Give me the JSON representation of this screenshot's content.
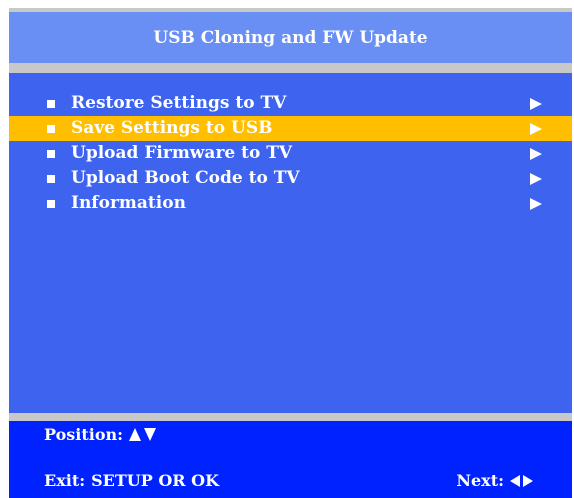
{
  "title": "USB Cloning and FW Update",
  "menu": {
    "items": [
      {
        "label": "Restore Settings to TV",
        "selected": false
      },
      {
        "label": "Save Settings to USB",
        "selected": true
      },
      {
        "label": "Upload Firmware to TV",
        "selected": false
      },
      {
        "label": "Upload Boot Code to TV",
        "selected": false
      },
      {
        "label": "Information",
        "selected": false
      }
    ],
    "bullet_icon": "square-bullet-icon",
    "submenu_icon": "right-triangle-arrow-icon"
  },
  "footer": {
    "position_label": "Position:",
    "position_icons": [
      "up-triangle-icon",
      "down-triangle-icon"
    ],
    "exit_label": "Exit:",
    "exit_keys": "SETUP OR OK",
    "next_label": "Next:",
    "next_icons": [
      "left-triangle-icon",
      "right-triangle-icon"
    ]
  },
  "colors": {
    "frame_blue": "#0022ff",
    "title_bar": "#6a8ff4",
    "list_panel": "#3d63ef",
    "highlight": "#ffbf00",
    "separator": "#c8c8c8",
    "text": "#ffffff"
  }
}
